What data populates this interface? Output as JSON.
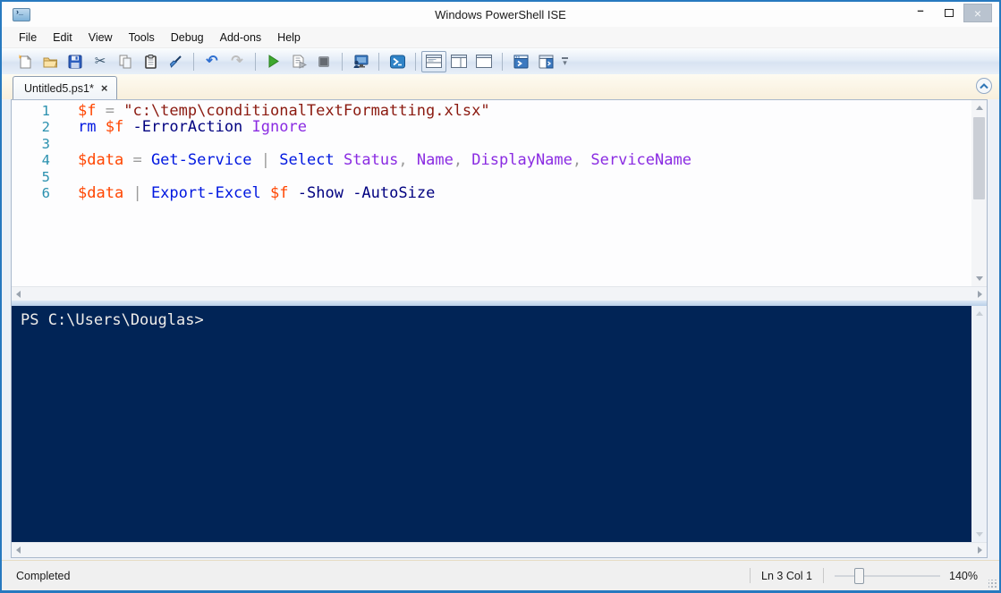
{
  "window": {
    "title": "Windows PowerShell ISE",
    "controls": {
      "minimize": "–",
      "maximize": "",
      "close": "×"
    }
  },
  "menu": {
    "items": [
      "File",
      "Edit",
      "View",
      "Tools",
      "Debug",
      "Add-ons",
      "Help"
    ]
  },
  "icons": {
    "cut": "✂",
    "undo": "↶",
    "redo": "↷",
    "overflow_chevron": "▾",
    "tab_close": "×"
  },
  "tab": {
    "label": "Untitled5.ps1*"
  },
  "editor": {
    "lines": [
      {
        "num": "1",
        "tokens": [
          {
            "text": "$f",
            "type": "variable"
          },
          {
            "text": " ",
            "type": "operator"
          },
          {
            "text": "=",
            "type": "operator"
          },
          {
            "text": " ",
            "type": "operator"
          },
          {
            "text": "\"c:\\temp\\conditionalTextFormatting.xlsx\"",
            "type": "string"
          }
        ]
      },
      {
        "num": "2",
        "tokens": [
          {
            "text": "rm",
            "type": "command"
          },
          {
            "text": " ",
            "type": "operator"
          },
          {
            "text": "$f",
            "type": "variable"
          },
          {
            "text": " ",
            "type": "operator"
          },
          {
            "text": "-ErrorAction",
            "type": "parameter"
          },
          {
            "text": " ",
            "type": "operator"
          },
          {
            "text": "Ignore",
            "type": "argument"
          }
        ]
      },
      {
        "num": "3",
        "tokens": []
      },
      {
        "num": "4",
        "tokens": [
          {
            "text": "$data",
            "type": "variable"
          },
          {
            "text": " ",
            "type": "operator"
          },
          {
            "text": "=",
            "type": "operator"
          },
          {
            "text": " ",
            "type": "operator"
          },
          {
            "text": "Get-Service",
            "type": "command"
          },
          {
            "text": " ",
            "type": "operator"
          },
          {
            "text": "|",
            "type": "operator"
          },
          {
            "text": " ",
            "type": "operator"
          },
          {
            "text": "Select",
            "type": "command"
          },
          {
            "text": " ",
            "type": "operator"
          },
          {
            "text": "Status",
            "type": "argument"
          },
          {
            "text": ", ",
            "type": "operator"
          },
          {
            "text": "Name",
            "type": "argument"
          },
          {
            "text": ", ",
            "type": "operator"
          },
          {
            "text": "DisplayName",
            "type": "argument"
          },
          {
            "text": ", ",
            "type": "operator"
          },
          {
            "text": "ServiceName",
            "type": "argument"
          }
        ]
      },
      {
        "num": "5",
        "tokens": []
      },
      {
        "num": "6",
        "tokens": [
          {
            "text": "$data",
            "type": "variable"
          },
          {
            "text": " ",
            "type": "operator"
          },
          {
            "text": "|",
            "type": "operator"
          },
          {
            "text": " ",
            "type": "operator"
          },
          {
            "text": "Export-Excel",
            "type": "command"
          },
          {
            "text": " ",
            "type": "operator"
          },
          {
            "text": "$f",
            "type": "variable"
          },
          {
            "text": " ",
            "type": "operator"
          },
          {
            "text": "-Show",
            "type": "parameter"
          },
          {
            "text": " ",
            "type": "operator"
          },
          {
            "text": "-AutoSize",
            "type": "parameter"
          }
        ]
      }
    ]
  },
  "console": {
    "prompt": "PS C:\\Users\\Douglas>"
  },
  "statusbar": {
    "status": "Completed",
    "position": "Ln 3 Col 1",
    "zoom": "140%"
  },
  "colors": {
    "variable": "#FF4500",
    "string": "#8B1A10",
    "command": "#0017E0",
    "parameter": "#000080",
    "argument": "#8A2BE2",
    "operator": "#9B9B9B",
    "lineNumber": "#2B91AF",
    "consoleBg": "#012456",
    "consoleFg": "#EFEDEA",
    "accent": "#2779BF"
  }
}
